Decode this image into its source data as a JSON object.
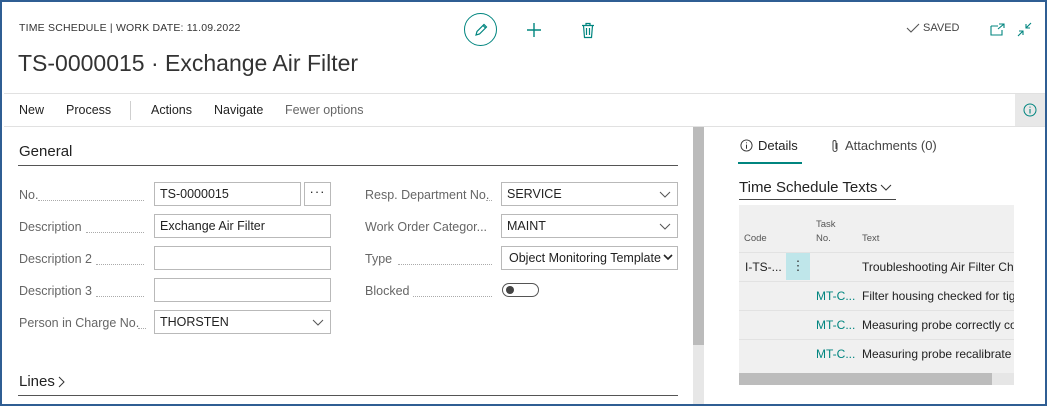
{
  "header": {
    "caption": "TIME SCHEDULE | WORK DATE: 11.09.2022",
    "title": "TS-0000015 · Exchange Air Filter",
    "saved_label": "SAVED"
  },
  "actions": [
    "New",
    "Process",
    "Actions",
    "Navigate",
    "Fewer options"
  ],
  "general": {
    "title": "General",
    "left_fields": [
      {
        "label": "No.",
        "value": "TS-0000015"
      },
      {
        "label": "Description",
        "value": "Exchange Air Filter"
      },
      {
        "label": "Description 2",
        "value": ""
      },
      {
        "label": "Description 3",
        "value": ""
      },
      {
        "label": "Person in Charge No.",
        "value": "THORSTEN"
      }
    ],
    "right_fields": [
      {
        "label": "Resp. Department No.",
        "value": "SERVICE"
      },
      {
        "label": "Work Order Categor...",
        "value": "MAINT"
      },
      {
        "label": "Type",
        "value": "Object Monitoring Template"
      },
      {
        "label": "Blocked",
        "value": "off"
      }
    ],
    "ellipsis": "···"
  },
  "lines": {
    "title": "Lines"
  },
  "factbox": {
    "tabs": [
      "Details",
      "Attachments (0)"
    ],
    "title": "Time Schedule Texts",
    "columns": {
      "code": "Code",
      "task_no_1": "Task",
      "task_no_2": "No.",
      "text": "Text"
    },
    "rows": [
      {
        "code": "I-TS-...",
        "task_no": "",
        "text": "Troubleshooting Air Filter Ch"
      },
      {
        "code": "",
        "task_no": "MT-C...",
        "text": "Filter housing checked for tig"
      },
      {
        "code": "",
        "task_no": "MT-C...",
        "text": "Measuring probe correctly co"
      },
      {
        "code": "",
        "task_no": "MT-C...",
        "text": "Measuring probe recalibrate"
      }
    ]
  },
  "colors": {
    "accent": "#00857f",
    "frame": "#2f5e93",
    "link": "#00857f"
  },
  "icons": [
    "edit-icon",
    "add-icon",
    "delete-icon",
    "check-icon",
    "open-new-window-icon",
    "collapse-icon",
    "info-icon",
    "chevron-down-icon",
    "chevron-right-icon",
    "paperclip-icon",
    "vertical-ellipsis-icon"
  ]
}
